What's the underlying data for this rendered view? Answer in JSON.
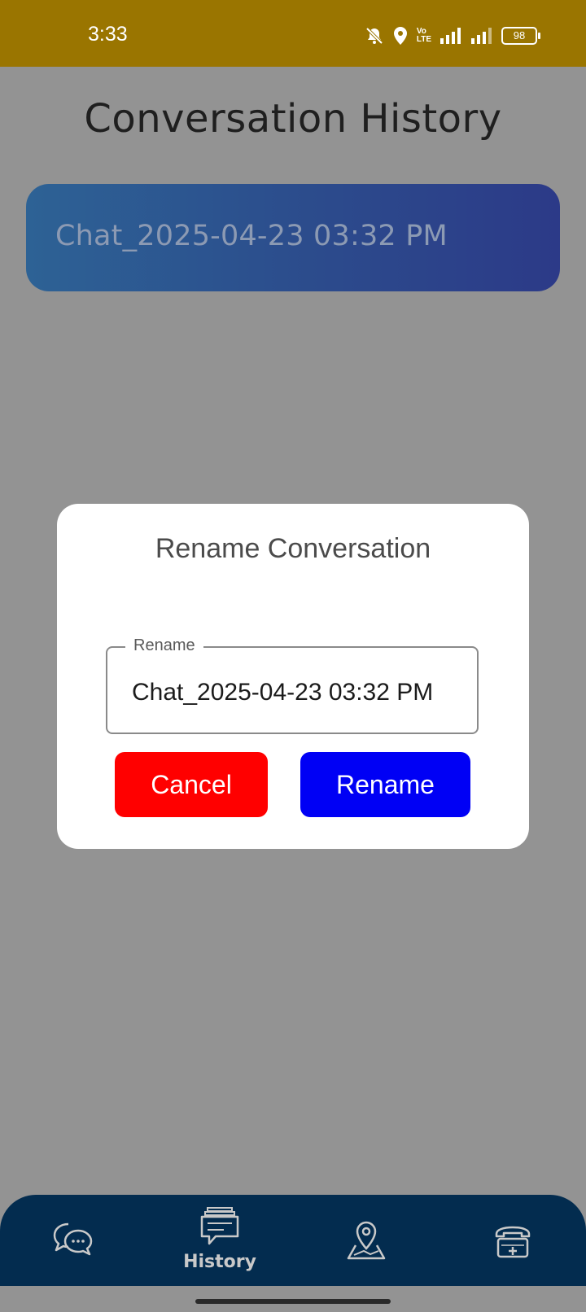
{
  "status_bar": {
    "time": "3:33",
    "battery": "98",
    "volte": "Vo\nLTE",
    "icons": [
      "bell-off-icon",
      "location-icon",
      "volte-icon",
      "signal-icon",
      "signal-icon",
      "battery-icon"
    ]
  },
  "page": {
    "title": "Conversation History"
  },
  "conversations": [
    {
      "label": "Chat_2025-04-23 03:32 PM"
    }
  ],
  "dialog": {
    "title": "Rename Conversation",
    "field_label": "Rename",
    "field_value": "Chat_2025-04-23 03:32 PM",
    "cancel_label": "Cancel",
    "rename_label": "Rename"
  },
  "bottom_nav": {
    "items": [
      {
        "icon": "chat-bubbles-icon",
        "label": ""
      },
      {
        "icon": "history-icon",
        "label": "History"
      },
      {
        "icon": "map-pin-icon",
        "label": ""
      },
      {
        "icon": "emergency-phone-icon",
        "label": ""
      }
    ],
    "active_index": 1
  },
  "colors": {
    "status_bar": "#9a7500",
    "overlay_bg": "#939393",
    "cancel": "#ff0000",
    "rename": "#0000f5",
    "nav_bg": "#032c4f"
  }
}
